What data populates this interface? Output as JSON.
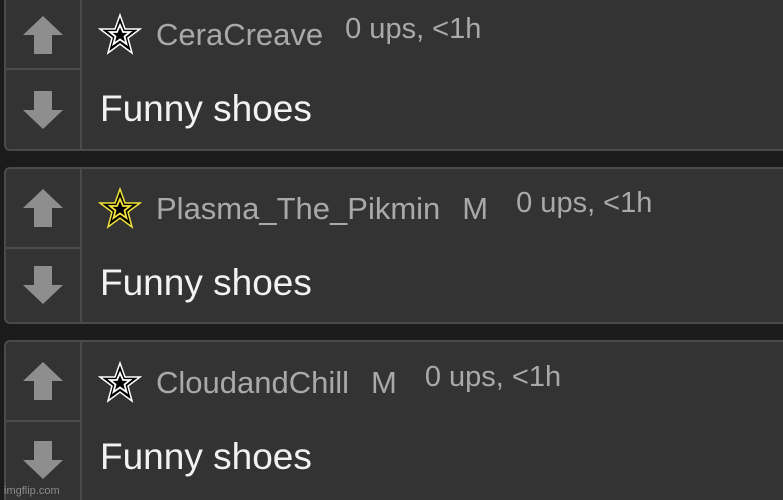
{
  "comments": [
    {
      "username": "CeraCreave",
      "mod_badge": "",
      "meta": "0 ups, <1h",
      "text": "Funny shoes",
      "star_icon": "star-outline-white-icon",
      "star_fill": "#ffffff"
    },
    {
      "username": "Plasma_The_Pikmin",
      "mod_badge": "M",
      "meta": "0 ups, <1h",
      "text": "Funny shoes",
      "star_icon": "star-outline-yellow-icon",
      "star_fill": "#f3e23a"
    },
    {
      "username": "CloudandChill",
      "mod_badge": "M",
      "meta": "0 ups, <1h",
      "text": "Funny shoes",
      "star_icon": "star-outline-white-icon",
      "star_fill": "#ffffff"
    }
  ],
  "icons": {
    "upvote": "arrow-up-icon",
    "downvote": "arrow-down-icon"
  },
  "colors": {
    "background": "#1b1b1b",
    "panel": "#333333",
    "border": "#4a4a4a",
    "arrow": "#8e8e8e",
    "username": "#a9a9a9",
    "text": "#f2f2f2"
  },
  "watermark": "imgflip.com"
}
